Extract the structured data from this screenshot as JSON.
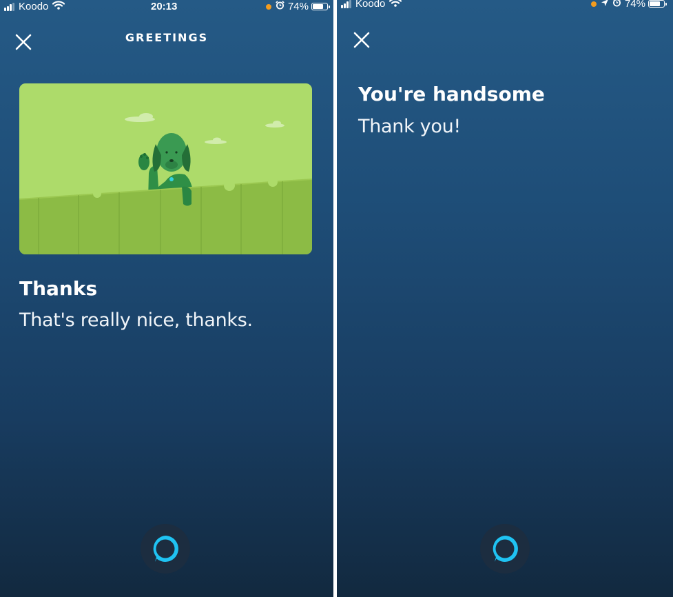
{
  "colors": {
    "accent": "#1fc3f3",
    "background_top": "#255a86",
    "background_bottom": "#12293f",
    "recording_dot": "#f39c1f",
    "card_green": "#a8d162"
  },
  "left_screen": {
    "status_bar": {
      "carrier": "Koodo",
      "time": "20:13",
      "battery_pct": "74%",
      "icons": [
        "signal-icon",
        "wifi-icon",
        "recording-dot",
        "alarm-icon",
        "battery-icon"
      ]
    },
    "header": {
      "title": "GREETINGS",
      "close_icon": "close-icon"
    },
    "card": {
      "image": "dog-waving-over-fence-illustration",
      "title": "Thanks",
      "subtitle": "That's really nice, thanks."
    },
    "alexa_button_icon": "alexa-ring-icon"
  },
  "right_screen": {
    "status_bar": {
      "carrier": "Koodo",
      "battery_pct": "74%",
      "icons": [
        "signal-icon",
        "wifi-icon",
        "recording-dot",
        "location-arrow-icon",
        "alarm-icon",
        "battery-icon"
      ]
    },
    "header": {
      "close_icon": "close-icon"
    },
    "card": {
      "title": "You're handsome",
      "subtitle": "Thank you!"
    },
    "alexa_button_icon": "alexa-ring-icon"
  }
}
